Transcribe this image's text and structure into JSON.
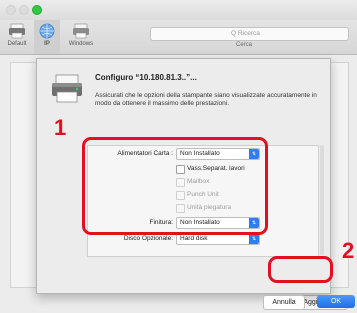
{
  "window": {
    "title": ""
  },
  "toolbar": {
    "items": [
      {
        "label": "Default",
        "icon": "default-printer-icon"
      },
      {
        "label": "IP",
        "icon": "ip-printer-icon"
      },
      {
        "label": "Windows",
        "icon": "windows-printer-icon"
      }
    ],
    "search_placeholder": "Q  Ricerca",
    "search_label": "Cerca"
  },
  "main": {
    "add_label": "Aggiungi"
  },
  "sheet": {
    "title": "Configuro “10.180.81.3..”...",
    "description": "Assicurati che le opzioni della stampante siano visualizzate accuratamente in modo da ottenere il massimo delle prestazioni.",
    "options": {
      "paper_feeder": {
        "label": "Alimentatori Carta :",
        "value": "Non Installato"
      },
      "checkboxes": [
        {
          "label": "Vass.Separat. lavori",
          "checked": false,
          "enabled": true
        },
        {
          "label": "Mailbox",
          "checked": false,
          "enabled": false
        },
        {
          "label": "Punch Unit",
          "checked": false,
          "enabled": false
        },
        {
          "label": "Unità piegatura",
          "checked": false,
          "enabled": false
        }
      ],
      "finisher": {
        "label": "Finitura:",
        "value": "Non Installato"
      },
      "hard_disk": {
        "label": "Disco Opzionale:",
        "value": "Hard disk"
      }
    },
    "cancel_label": "Annulla",
    "ok_label": "OK"
  },
  "annotations": {
    "step1": "1",
    "step2": "2",
    "color": "#e3101f"
  },
  "colors": {
    "accent": "#2f7cf6",
    "highlight": "#e3101f"
  }
}
